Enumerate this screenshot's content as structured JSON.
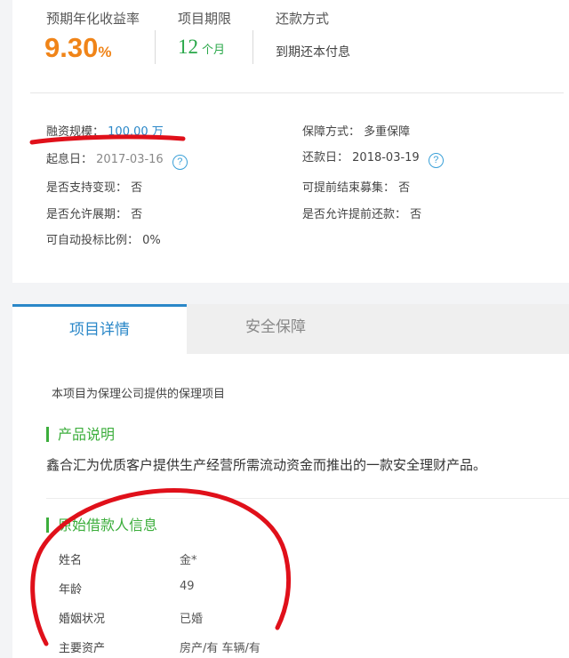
{
  "summary": {
    "rate_label": "预期年化收益率",
    "rate_number": "9.30",
    "rate_unit": "%",
    "term_label": "项目期限",
    "term_number": "12",
    "term_unit": "个月",
    "repay_label": "还款方式",
    "repay_value": "到期还本付息"
  },
  "details": {
    "financing_label": "融资规模：",
    "financing_value": "100.00 万",
    "guarantee_label": "保障方式：",
    "guarantee_value": "多重保障",
    "start_label": "起息日：",
    "start_value": "2017-03-16",
    "repay_date_label": "还款日：",
    "repay_date_value": "2018-03-19",
    "cashout_label": "是否支持变现：",
    "cashout_value": "否",
    "early_end_label": "可提前结束募集：",
    "early_end_value": "否",
    "extension_label": "是否允许展期：",
    "extension_value": "否",
    "early_repay_label": "是否允许提前还款：",
    "early_repay_value": "否",
    "auto_bid_label": "可自动投标比例：",
    "auto_bid_value": "0%",
    "help_glyph": "?"
  },
  "tabs": {
    "active": "项目详情",
    "inactive": "安全保障"
  },
  "content": {
    "intro": "本项目为保理公司提供的保理项目",
    "product_title": "产品说明",
    "product_desc": "鑫合汇为优质客户提供生产经营所需流动资金而推出的一款安全理财产品。",
    "borrower_title": "原始借款人信息",
    "borrower": {
      "name_label": "姓名",
      "name_value": "金*",
      "age_label": "年龄",
      "age_value": "49",
      "marital_label": "婚姻状况",
      "marital_value": "已婚",
      "assets_label": "主要资产",
      "assets_value": "房产/有 车辆/有"
    }
  },
  "colors": {
    "rate": "#f08418",
    "term": "#2aa84a",
    "accent": "#2a87c8",
    "section": "#3cae3c",
    "annotation": "#e0101a"
  }
}
